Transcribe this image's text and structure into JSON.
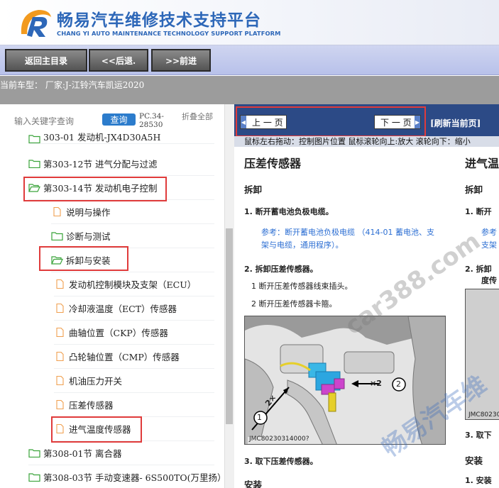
{
  "header": {
    "title": "畅易汽车维修技术支持平台",
    "subtitle": "CHANG YI AUTO MAINTENANCE TECHNOLOGY SUPPORT PLATFORM"
  },
  "nav": {
    "home": "返回主目录",
    "back": "<<后退.",
    "forward": ">>前进"
  },
  "vehicle": {
    "label": "当前车型： 厂家:J-江铃汽车凯运2020"
  },
  "sidebar": {
    "search_hint": "输入关键字查询",
    "search_button": "查询",
    "pc_code": "PC.34-28530",
    "collapse_all": "折叠全部",
    "items": [
      {
        "label": "303-01 发动机-JX4D30A5H"
      },
      {
        "label": "第303-12节 进气分配与过滤"
      },
      {
        "label": "第303-14节 发动机电子控制"
      },
      {
        "label": "说明与操作"
      },
      {
        "label": "诊断与测试"
      },
      {
        "label": "拆卸与安装"
      },
      {
        "label": "发动机控制模块及支架（ECU）"
      },
      {
        "label": "冷却液温度（ECT）传感器"
      },
      {
        "label": "曲轴位置（CKP）传感器"
      },
      {
        "label": "凸轮轴位置（CMP）传感器"
      },
      {
        "label": "机油压力开关"
      },
      {
        "label": "压差传感器"
      },
      {
        "label": "进气温度传感器"
      },
      {
        "label": "第308-01节 离合器"
      },
      {
        "label": "第308-03节 手动变速器- 6S500TO(万里扬）"
      }
    ]
  },
  "viewer": {
    "prev": "上 一 页",
    "next": "下 一 页",
    "refresh": "[刷新当前页]",
    "instruction": "鼠标左右拖动：控制图片位置 鼠标滚轮向上:放大 滚轮向下：缩小"
  },
  "doc": {
    "title": "压差传感器",
    "section_remove": "拆卸",
    "step1": "1.  断开蓄电池负极电缆。",
    "ref": "参考：断开蓄电池负极电缆 （414-01 蓄电池、支架与电缆，通用程序）。",
    "step2": "2.  拆卸压差传感器。",
    "sub1": "1 断开压差传感器线束插头。",
    "sub2": "2 断开压差传感器卡箍。",
    "figure_code": "JMC80230314000?",
    "figure_label1": "1",
    "figure_label2": "2",
    "figure_x": "×2",
    "figure_2x": "2×",
    "step3": "3.  取下压差传感器。",
    "section_install": "安装",
    "col2_title": "进气温",
    "col2_remove": "拆卸",
    "col2_step1": "1.  断开",
    "col2_ref1": "参考",
    "col2_ref2": "支架",
    "col2_step2": "2.  拆卸",
    "col2_step2b": "度传",
    "col2_fig_code": "JMC80230",
    "col2_step3": "3.  取下",
    "col2_install": "安装",
    "col2_step_install": "1.  安装"
  },
  "watermarks": {
    "site": "car388.com",
    "brand": "畅易汽车维"
  },
  "colors": {
    "brand_blue": "#2d67b8",
    "toolbar": "#2c4a86",
    "highlight": "#e03b3b",
    "reference_link": "#2d6fd3"
  }
}
